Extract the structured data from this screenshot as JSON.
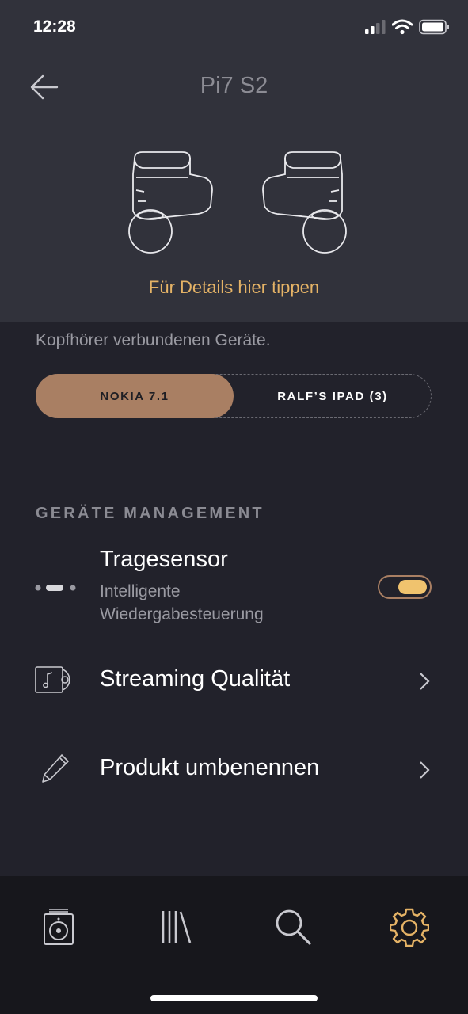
{
  "status_bar": {
    "time": "12:28"
  },
  "header": {
    "title": "Pi7 S2",
    "details_link": "Für Details hier tippen"
  },
  "connected_text": "Kopfhörer verbundenen Geräte.",
  "devices": {
    "active": "NOKIA 7.1",
    "inactive": "RALF’S IPAD (3)"
  },
  "section": {
    "heading": "GERÄTE MANAGEMENT",
    "wear_sensor": {
      "title": "Tragesensor",
      "subtitle_line1": "Intelligente",
      "subtitle_line2": "Wiedergabesteuerung",
      "enabled": true
    },
    "streaming": {
      "title": "Streaming Qualität"
    },
    "rename": {
      "title": "Produkt umbenennen"
    }
  },
  "bottom_nav": {
    "items": [
      "speaker-icon",
      "library-icon",
      "search-icon",
      "settings-icon"
    ],
    "active": "settings-icon"
  },
  "colors": {
    "accent_gold": "#e5b366",
    "segment_active": "#a97f63",
    "background": "#22222b",
    "header_bg": "#31323b"
  }
}
